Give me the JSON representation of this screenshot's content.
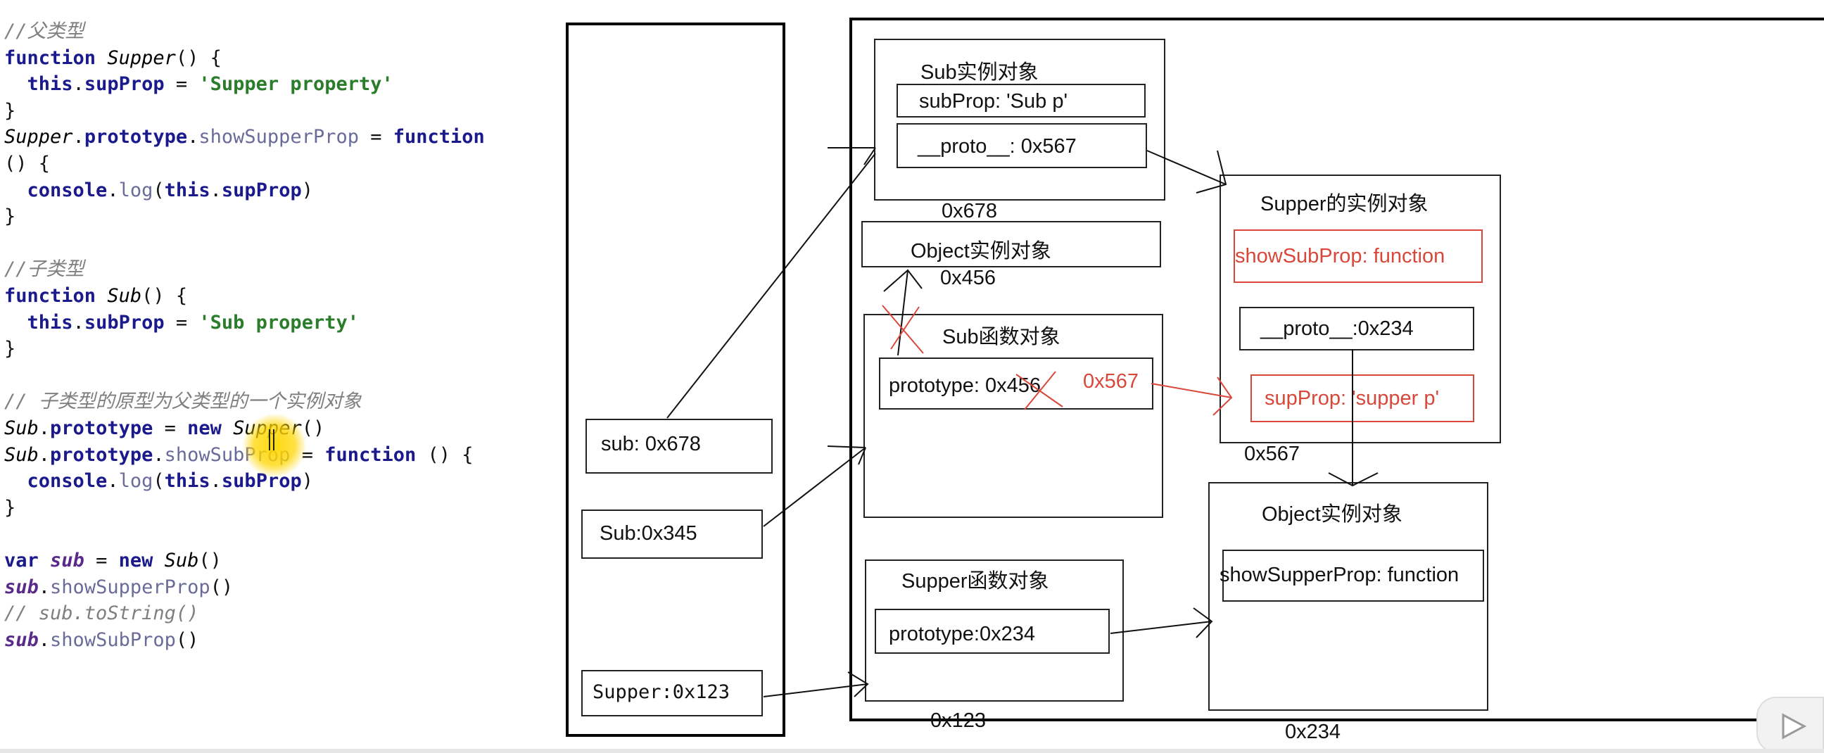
{
  "code": {
    "lines": [
      [
        {
          "c": "cm",
          "t": "//父类型"
        }
      ],
      [
        {
          "c": "kw",
          "t": "function "
        },
        {
          "c": "it",
          "t": "Supper"
        },
        {
          "c": "tx",
          "t": "() {"
        }
      ],
      [
        {
          "c": "tx",
          "t": "  "
        },
        {
          "c": "kw",
          "t": "this"
        },
        {
          "c": "tx",
          "t": "."
        },
        {
          "c": "pr",
          "t": "supProp"
        },
        {
          "c": "tx",
          "t": " = "
        },
        {
          "c": "st",
          "t": "'Supper property'"
        }
      ],
      [
        {
          "c": "tx",
          "t": "}"
        }
      ],
      [
        {
          "c": "it",
          "t": "Supper"
        },
        {
          "c": "tx",
          "t": "."
        },
        {
          "c": "pr",
          "t": "prototype"
        },
        {
          "c": "tx",
          "t": "."
        },
        {
          "c": "fn",
          "t": "showSupperProp"
        },
        {
          "c": "tx",
          "t": " = "
        },
        {
          "c": "kw",
          "t": "function"
        }
      ],
      [
        {
          "c": "tx",
          "t": "() {"
        }
      ],
      [
        {
          "c": "tx",
          "t": "  "
        },
        {
          "c": "pr",
          "t": "console"
        },
        {
          "c": "tx",
          "t": "."
        },
        {
          "c": "fn",
          "t": "log"
        },
        {
          "c": "tx",
          "t": "("
        },
        {
          "c": "kw",
          "t": "this"
        },
        {
          "c": "tx",
          "t": "."
        },
        {
          "c": "pr",
          "t": "supProp"
        },
        {
          "c": "tx",
          "t": ")"
        }
      ],
      [
        {
          "c": "tx",
          "t": "}"
        }
      ],
      [
        {
          "c": "tx",
          "t": ""
        }
      ],
      [
        {
          "c": "cm",
          "t": "//子类型"
        }
      ],
      [
        {
          "c": "kw",
          "t": "function "
        },
        {
          "c": "it",
          "t": "Sub"
        },
        {
          "c": "tx",
          "t": "() {"
        }
      ],
      [
        {
          "c": "tx",
          "t": "  "
        },
        {
          "c": "kw",
          "t": "this"
        },
        {
          "c": "tx",
          "t": "."
        },
        {
          "c": "pr",
          "t": "subProp"
        },
        {
          "c": "tx",
          "t": " = "
        },
        {
          "c": "st",
          "t": "'Sub property'"
        }
      ],
      [
        {
          "c": "tx",
          "t": "}"
        }
      ],
      [
        {
          "c": "tx",
          "t": ""
        }
      ],
      [
        {
          "c": "cm",
          "t": "// 子类型的原型为父类型的一个实例对象"
        }
      ],
      [
        {
          "c": "it",
          "t": "Sub"
        },
        {
          "c": "tx",
          "t": "."
        },
        {
          "c": "pr",
          "t": "prototype"
        },
        {
          "c": "tx",
          "t": " = "
        },
        {
          "c": "kw",
          "t": "new "
        },
        {
          "c": "it",
          "t": "Supper"
        },
        {
          "c": "tx",
          "t": "()"
        }
      ],
      [
        {
          "c": "it",
          "t": "Sub"
        },
        {
          "c": "tx",
          "t": "."
        },
        {
          "c": "pr",
          "t": "prototype"
        },
        {
          "c": "tx",
          "t": "."
        },
        {
          "c": "fn",
          "t": "showSubProp"
        },
        {
          "c": "tx",
          "t": " = "
        },
        {
          "c": "kw",
          "t": "function"
        },
        {
          "c": "tx",
          "t": " () {"
        }
      ],
      [
        {
          "c": "tx",
          "t": "  "
        },
        {
          "c": "pr",
          "t": "console"
        },
        {
          "c": "tx",
          "t": "."
        },
        {
          "c": "fn",
          "t": "log"
        },
        {
          "c": "tx",
          "t": "("
        },
        {
          "c": "kw",
          "t": "this"
        },
        {
          "c": "tx",
          "t": "."
        },
        {
          "c": "pr",
          "t": "subProp"
        },
        {
          "c": "tx",
          "t": ")"
        }
      ],
      [
        {
          "c": "tx",
          "t": "}"
        }
      ],
      [
        {
          "c": "tx",
          "t": ""
        }
      ],
      [
        {
          "c": "kw",
          "t": "var "
        },
        {
          "c": "vr",
          "t": "sub"
        },
        {
          "c": "tx",
          "t": " = "
        },
        {
          "c": "kw",
          "t": "new "
        },
        {
          "c": "it",
          "t": "Sub"
        },
        {
          "c": "tx",
          "t": "()"
        }
      ],
      [
        {
          "c": "vr",
          "t": "sub"
        },
        {
          "c": "tx",
          "t": "."
        },
        {
          "c": "fn",
          "t": "showSupperProp"
        },
        {
          "c": "tx",
          "t": "()"
        }
      ],
      [
        {
          "c": "cm",
          "t": "// sub.toString()"
        }
      ],
      [
        {
          "c": "vr",
          "t": "sub"
        },
        {
          "c": "tx",
          "t": "."
        },
        {
          "c": "fn",
          "t": "showSubProp"
        },
        {
          "c": "tx",
          "t": "()"
        }
      ]
    ]
  },
  "stack": {
    "sub": "sub: 0x678",
    "sub_ctor": "Sub:0x345",
    "supper_ctor": "Supper:0x123"
  },
  "heap": {
    "sub_instance": {
      "title": "Sub实例对象",
      "subprop": "subProp: 'Sub p'",
      "proto": "__proto__: 0x567",
      "addr": "0x678"
    },
    "object_instance_1": {
      "title": "Object实例对象",
      "addr": "0x456"
    },
    "sub_function": {
      "title": "Sub函数对象",
      "prototype": "prototype: 0x456",
      "new_addr": "0x567"
    },
    "supper_function": {
      "title": "Supper函数对象",
      "prototype": "prototype:0x234",
      "addr": "0x123"
    },
    "supper_instance": {
      "title": "Supper的实例对象",
      "showsubprop": "showSubProp: function",
      "proto": "__proto__:0x234",
      "supprop": "supProp: 'supper p'",
      "addr": "0x567"
    },
    "object_instance_2": {
      "title": "Object实例对象",
      "showsupperprop": "showSupperProp: function",
      "addr": "0x234"
    }
  },
  "colors": {
    "annotation_red": "#d9473a",
    "string_green": "#2a7d2a",
    "keyword_navy": "#1a1a8c",
    "highlight_yellow": "#ffd600"
  },
  "icons": [
    "play-icon",
    "text-cursor-icon"
  ]
}
